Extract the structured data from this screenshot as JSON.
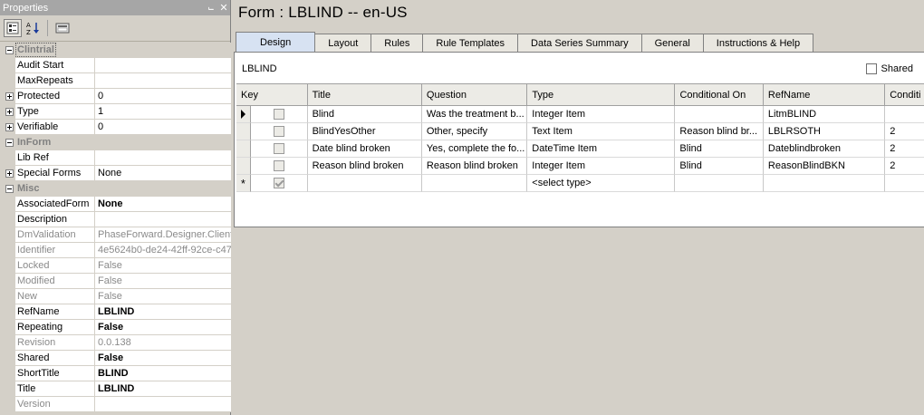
{
  "properties": {
    "title": "Properties",
    "pin_glyph": "⨽",
    "close_glyph": "✕",
    "categories": [
      {
        "name": "Clintrial",
        "items": [
          {
            "name": "Audit Start",
            "value": "",
            "style": "",
            "expander": ""
          },
          {
            "name": "MaxRepeats",
            "value": "",
            "style": "",
            "expander": ""
          },
          {
            "name": "Protected",
            "value": "0",
            "style": "",
            "expander": "plus"
          },
          {
            "name": "Type",
            "value": "1",
            "style": "",
            "expander": "plus"
          },
          {
            "name": "Verifiable",
            "value": "0",
            "style": "",
            "expander": "plus"
          }
        ]
      },
      {
        "name": "InForm",
        "items": [
          {
            "name": "Lib Ref",
            "value": "",
            "style": "",
            "expander": ""
          },
          {
            "name": "Special Forms",
            "value": "None",
            "style": "",
            "expander": "plus"
          }
        ]
      },
      {
        "name": "Misc",
        "items": [
          {
            "name": "AssociatedForm",
            "value": "None",
            "style": "bold",
            "expander": ""
          },
          {
            "name": "Description",
            "value": "",
            "style": "",
            "expander": ""
          },
          {
            "name": "DmValidation",
            "value": "PhaseForward.Designer.Client",
            "style": "ro",
            "expander": ""
          },
          {
            "name": "Identifier",
            "value": "4e5624b0-de24-42ff-92ce-c47",
            "style": "ro",
            "expander": ""
          },
          {
            "name": "Locked",
            "value": "False",
            "style": "ro",
            "expander": ""
          },
          {
            "name": "Modified",
            "value": "False",
            "style": "ro",
            "expander": ""
          },
          {
            "name": "New",
            "value": "False",
            "style": "ro",
            "expander": ""
          },
          {
            "name": "RefName",
            "value": "LBLIND",
            "style": "bold",
            "expander": ""
          },
          {
            "name": "Repeating",
            "value": "False",
            "style": "bold",
            "expander": ""
          },
          {
            "name": "Revision",
            "value": "0.0.138",
            "style": "ro",
            "expander": ""
          },
          {
            "name": "Shared",
            "value": "False",
            "style": "bold",
            "expander": ""
          },
          {
            "name": "ShortTitle",
            "value": "BLIND",
            "style": "bold",
            "expander": ""
          },
          {
            "name": "Title",
            "value": "LBLIND",
            "style": "bold",
            "expander": ""
          },
          {
            "name": "Version",
            "value": "",
            "style": "ro",
            "expander": ""
          }
        ]
      }
    ]
  },
  "form": {
    "title": "Form : LBLIND -- en-US",
    "tabs": [
      "Design",
      "Layout",
      "Rules",
      "Rule Templates",
      "Data Series Summary",
      "General",
      "Instructions & Help"
    ],
    "active_tab": "Design",
    "form_name": "LBLIND",
    "shared_label": "Shared",
    "grid": {
      "columns": [
        "Key",
        "Title",
        "Question",
        "Type",
        "Conditional On",
        "RefName",
        "Conditi"
      ],
      "rows": [
        {
          "marker": "current",
          "title": "Blind",
          "question": "Was the treatment b...",
          "type": "Integer Item",
          "cond": "",
          "ref": "LitmBLIND",
          "condi": ""
        },
        {
          "marker": "",
          "title": "BlindYesOther",
          "question": "Other, specify",
          "type": "Text Item",
          "cond": "Reason blind br...",
          "ref": "LBLRSOTH",
          "condi": "2"
        },
        {
          "marker": "",
          "title": "Date blind broken",
          "question": "Yes, complete the fo...",
          "type": "DateTime Item",
          "cond": "Blind",
          "ref": "Dateblindbroken",
          "condi": "2"
        },
        {
          "marker": "",
          "title": "Reason blind broken",
          "question": "Reason blind broken",
          "type": "Integer Item",
          "cond": "Blind",
          "ref": "ReasonBlindBKN",
          "condi": "2"
        }
      ],
      "new_row_marker": "*",
      "new_row_type": "<select type>"
    }
  }
}
